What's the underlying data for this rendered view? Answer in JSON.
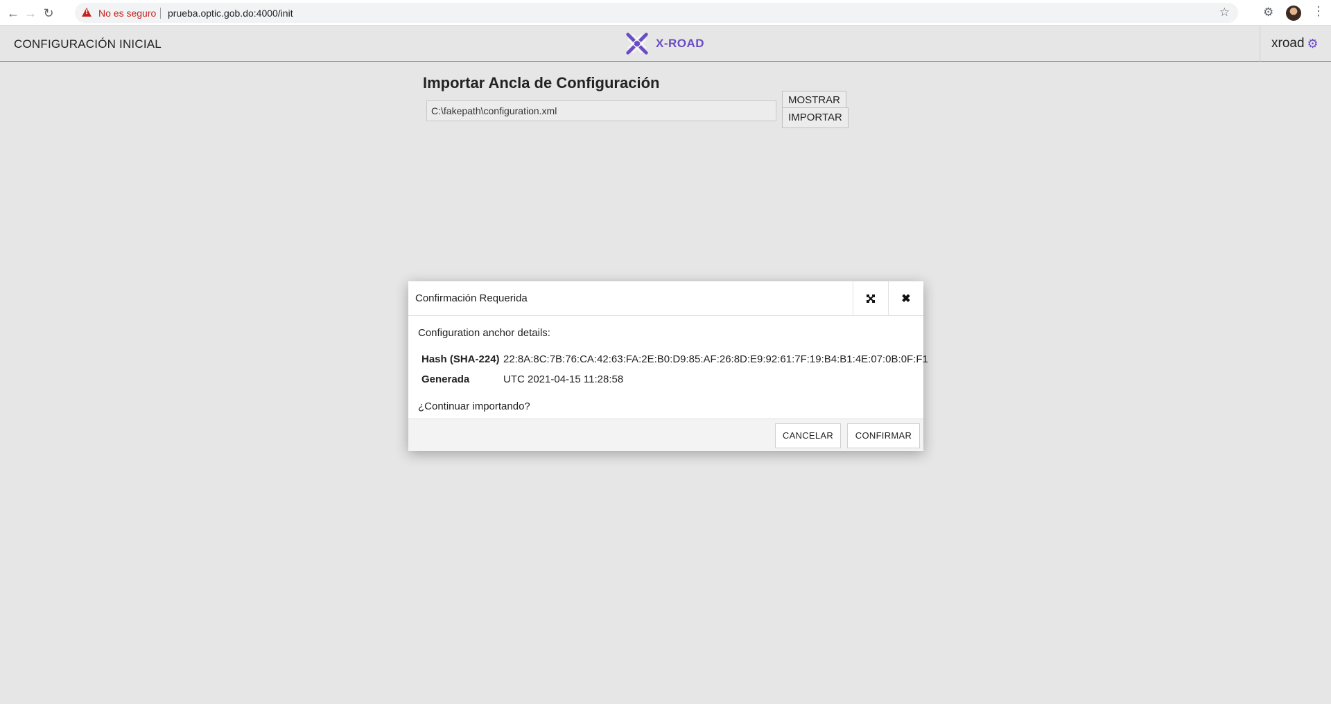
{
  "browser": {
    "insecure_label": "No es seguro",
    "url": "prueba.optic.gob.do:4000/init"
  },
  "header": {
    "title": "CONFIGURACIÓN INICIAL",
    "logo_text": "X-ROAD",
    "username": "xroad"
  },
  "import": {
    "title": "Importar Ancla de Configuración",
    "file_value": "C:\\fakepath\\configuration.xml",
    "browse_label": "MOSTRAR",
    "import_label": "IMPORTAR"
  },
  "dialog": {
    "title": "Confirmación Requerida",
    "intro": "Configuration anchor details:",
    "hash_label": "Hash (SHA-224)",
    "hash_value": "22:8A:8C:7B:76:CA:42:63:FA:2E:B0:D9:85:AF:26:8D:E9:92:61:7F:19:B4:B1:4E:07:0B:0F:F1",
    "generated_label": "Generada",
    "generated_value": "UTC 2021-04-15 11:28:58",
    "question": "¿Continuar importando?",
    "cancel_label": "CANCELAR",
    "confirm_label": "CONFIRMAR"
  },
  "colors": {
    "accent": "#6a4bc4",
    "background": "#e6e6e6",
    "insecure": "#c5221f"
  },
  "icons": {
    "back": "arrow-left-icon",
    "forward": "arrow-right-icon",
    "reload": "reload-icon",
    "warning": "warning-icon",
    "bookmark": "star-icon",
    "extensions": "puzzle-icon",
    "menu": "kebab-menu-icon",
    "user_settings": "gear-icon",
    "maximize": "maximize-icon",
    "close": "close-icon"
  }
}
